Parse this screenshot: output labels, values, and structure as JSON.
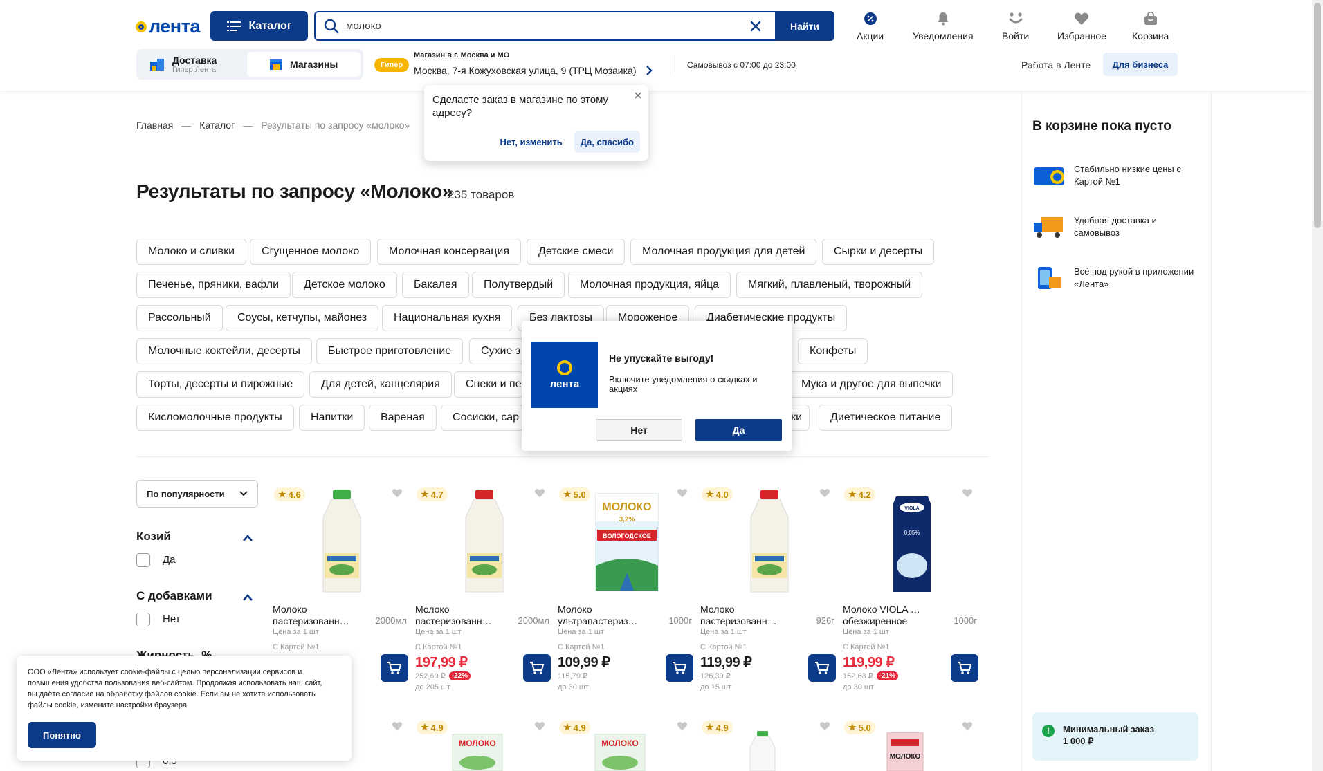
{
  "header": {
    "logo_text": "лента",
    "catalog_label": "Каталог",
    "search_value": "молоко",
    "search_button": "Найти",
    "icons": [
      {
        "label": "Акции",
        "icon": "percent-icon"
      },
      {
        "label": "Уведомления",
        "icon": "bell-icon"
      },
      {
        "label": "Войти",
        "icon": "user-icon"
      },
      {
        "label": "Избранное",
        "icon": "heart-icon"
      },
      {
        "label": "Корзина",
        "icon": "cart-icon"
      }
    ],
    "delivery_tab": {
      "label": "Доставка",
      "sub": "Гипер Лента"
    },
    "stores_tab": {
      "label": "Магазины"
    },
    "store_badge": "Гипер",
    "store_region": "Магазин в г. Москва и МО",
    "store_address": "Москва, 7-я Кожуховская улица, 9 (ТРЦ Мозаика)",
    "pickup_hours": "Самовывоз с 07:00 до 23:00",
    "work_link": "Работа в Ленте",
    "business_button": "Для бизнеса"
  },
  "tooltip": {
    "question": "Сделаете заказ в магазине по этому адресу?",
    "no_label": "Нет, изменить",
    "yes_label": "Да, спасибо"
  },
  "breadcrumbs": [
    "Главная",
    "Каталог",
    "Результаты по запросу «молоко»"
  ],
  "page": {
    "title": "Результаты по запросу «Молоко»",
    "count": "235 товаров"
  },
  "chips": [
    "Молоко и сливки",
    "Сгущенное молоко",
    "Молочная консервация",
    "Детские смеси",
    "Молочная продукция для детей",
    "Сырки и десерты",
    "Печенье, пряники, вафли",
    "Детское молоко",
    "Бакалея",
    "Полутвердый",
    "Молочная продукция, яйца",
    "Мягкий, плавленый, творожный",
    "Рассольный",
    "Соусы, кетчупы, майонез",
    "Национальная кухня",
    "Без лактозы",
    "Мороженое",
    "Диабетические продукты",
    "Молочные коктейли, десерты",
    "Быстрое приготовление",
    "Сухие з",
    "Конфеты",
    "Торты, десерты и пирожные",
    "Для детей, канцелярия",
    "Снеки и пе",
    "Мука и другое для выпечки",
    "Кисломолочные продукты",
    "Напитки",
    "Вареная",
    "Сосиски, сар",
    "ки",
    "Диетическое питание"
  ],
  "filters": {
    "sort_label": "По популярности",
    "groups": [
      {
        "title": "Козий",
        "option": "Да"
      },
      {
        "title": "С добавками",
        "option": "Нет"
      },
      {
        "title": "Жирность, %",
        "option": "0,5"
      }
    ]
  },
  "products": [
    {
      "rating": "4.6",
      "name1": "Молоко",
      "name2": "пастеризованн…",
      "weight": "2000мл",
      "per": "Цена за 1 шт",
      "card_label": "С Картой №1",
      "price": "",
      "old_price": "",
      "discount": "",
      "stock": "",
      "red": false
    },
    {
      "rating": "4.7",
      "name1": "Молоко",
      "name2": "пастеризованн…",
      "weight": "2000мл",
      "per": "Цена за 1 шт",
      "card_label": "С Картой №1",
      "price": "197,99 ₽",
      "old_price": "252,69 ₽",
      "discount": "-22%",
      "stock": "до 205 шт",
      "red": true
    },
    {
      "rating": "5.0",
      "name1": "Молоко",
      "name2": "ультрапастеризов…",
      "weight": "1000г",
      "per": "Цена за 1 шт",
      "card_label": "С Картой №1",
      "price": "109,99 ₽",
      "old_price": "115,79 ₽",
      "discount": "",
      "stock": "до 30 шт",
      "red": false
    },
    {
      "rating": "4.0",
      "name1": "Молоко",
      "name2": "пастеризованное…",
      "weight": "926г",
      "per": "Цена за 1 шт",
      "card_label": "С Картой №1",
      "price": "119,99 ₽",
      "old_price": "126,39 ₽",
      "discount": "",
      "stock": "до 15 шт",
      "red": false
    },
    {
      "rating": "4.2",
      "name1": "Молоко VIOLA UHT",
      "name2": "обезжиренное",
      "weight": "1000г",
      "per": "Цена за 1 шт",
      "card_label": "С Картой №1",
      "price": "119,99 ₽",
      "old_price": "152,63 ₽",
      "discount": "-21%",
      "stock": "до 30 шт",
      "red": true
    }
  ],
  "products_row2_ratings": [
    "4.9",
    "4.9",
    "4.9",
    "5.0"
  ],
  "product_labels": {
    "moloko": "МОЛОКО",
    "fat": "3,2%",
    "brand": "ВОЛОГОДСКОЕ",
    "viola": "VIOLA",
    "viola_fat": "0,05%"
  },
  "cookie": {
    "text": "ООО «Лента» использует cookie-файлы с целью персонализации сервисов и повышения удобства пользования веб-сайтом. Продолжая использовать наш сайт, вы даёте согласие на обработку файлов cookie. Если вы не хотите использовать файлы cookie, измените настройки браузера",
    "button": "Понятно"
  },
  "notification": {
    "logo_text": "лента",
    "title": "Не упускайте выгоду!",
    "desc": "Включите уведомления о скидках и акциях",
    "no": "Нет",
    "yes": "Да"
  },
  "cart": {
    "title": "В корзине пока пусто",
    "perks": [
      "Стабильно низкие цены с Картой №1",
      "Удобная доставка и самовывоз",
      "Всё под рукой в приложении «Лента»"
    ],
    "min_order_title": "Минимальный заказ",
    "min_order_value": "1 000 ₽"
  },
  "colors": {
    "brand": "#0c3b8a",
    "accent_yellow": "#f7b500",
    "sale_red": "#e8283b"
  }
}
